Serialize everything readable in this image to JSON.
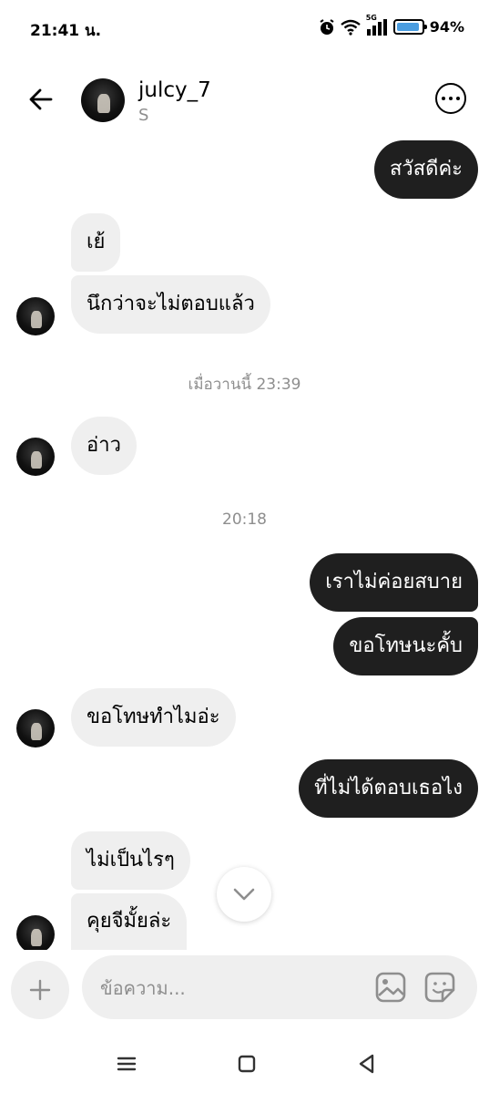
{
  "status": {
    "time": "21:41 น.",
    "network": "5G",
    "battery_percent": "94%",
    "battery_level": 0.94
  },
  "header": {
    "name": "julcy_7",
    "subtitle": "S"
  },
  "messages": [
    {
      "text": "สวัสดีค่ะ"
    },
    {
      "text": "เย้"
    },
    {
      "text": "นึกว่าจะไม่ตอบแล้ว"
    },
    {
      "text": "อ่าว"
    },
    {
      "text": "เราไม่ค่อยสบาย"
    },
    {
      "text": "ขอโทษนะคั้บ"
    },
    {
      "text": "ขอโทษทำไมอ่ะ"
    },
    {
      "text": "ที่ไม่ได้ตอบเธอไง"
    },
    {
      "text": "ไม่เป็นไรๆ"
    },
    {
      "text": "คุยจีมั้ยล่ะ"
    }
  ],
  "timestamps": [
    "เมื่อวานนี้ 23:39",
    "20:18"
  ],
  "composer": {
    "placeholder": "ข้อความ..."
  },
  "colors": {
    "outgoing_bubble": "#1f1f1f",
    "incoming_bubble": "#efefef",
    "meta_text": "#8e8e8e"
  }
}
